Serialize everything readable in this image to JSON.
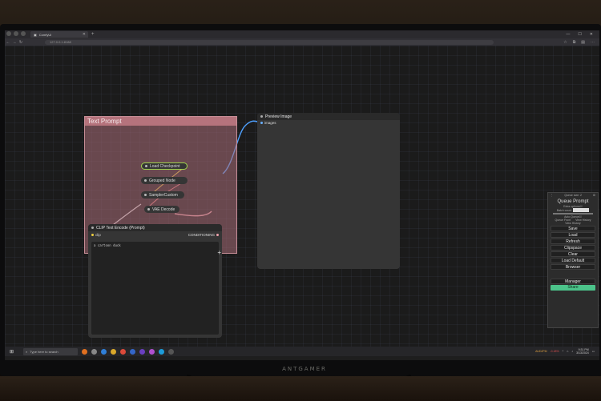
{
  "browser": {
    "tab_title": "ComfyUI",
    "url": "127.0.0.1:8188",
    "new_tab_glyph": "+",
    "window_controls": [
      "—",
      "☐",
      "✕"
    ]
  },
  "canvas": {
    "group": {
      "title": "Text Prompt"
    },
    "chips": [
      {
        "label": "Load Checkpoint"
      },
      {
        "label": "Grouped Node"
      },
      {
        "label": "SamplerCustom"
      },
      {
        "label": "VAE Decode"
      }
    ],
    "clip_node": {
      "title": "CLIP Text Encode (Prompt)",
      "input_label": "clip",
      "output_label": "CONDITIONING",
      "text": "a cartoon duck"
    },
    "preview_node": {
      "title": "Preview Image",
      "input_label": "images"
    }
  },
  "menu": {
    "queue_size": "Queue size: 2",
    "queue_prompt": "Queue Prompt",
    "extra_options": "Extra options",
    "batch_count": "Batch count",
    "auto_queue": "Auto Queue",
    "view_queue": "Queue Front",
    "view_history": "View History",
    "history_label": "View History",
    "buttons": [
      "Save",
      "Load",
      "Refresh",
      "Clipspace",
      "Clear",
      "Load Default",
      "Browser"
    ],
    "manager": "Manager",
    "share": "Share"
  },
  "taskbar": {
    "search_placeholder": "Type here to search",
    "weather": "AUDJPM",
    "weather_change": "-0.18%",
    "time": "9:31 PM",
    "date": "3/13/2024"
  },
  "monitor_brand": "ANTGAMER",
  "colors": {
    "group_bg": "#b06e78",
    "selected_border": "#9fd44d",
    "link_blue": "#4ea1ff",
    "share_green": "#4cc38a"
  }
}
